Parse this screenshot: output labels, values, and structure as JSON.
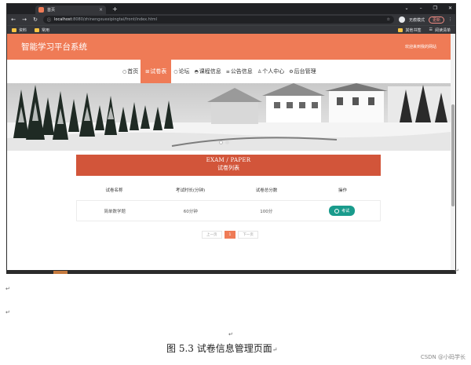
{
  "browser": {
    "tab_title": "首页",
    "tab_close": "×",
    "new_tab": "+",
    "window_controls": [
      "⌄",
      "–",
      "❐",
      "✕"
    ],
    "url_host": "localhost",
    "url_path": ":8080/zhinengxuexipingtai/front/index.html",
    "profile_label": "无痕模式",
    "update_label": "更新",
    "bookmarks": [
      "资料",
      "常用"
    ],
    "bookmarks_right": [
      "其他书签",
      "阅读清单"
    ]
  },
  "site": {
    "title": "智能学习平台系统",
    "welcome": "欢迎来到我的网站",
    "nav": [
      {
        "icon": "○",
        "label": "首页",
        "active": false
      },
      {
        "icon": "⊞",
        "label": "试卷表",
        "active": true
      },
      {
        "icon": "○",
        "label": "论坛",
        "active": false
      },
      {
        "icon": "◓",
        "label": "课程信息",
        "active": false
      },
      {
        "icon": "≡",
        "label": "公告信息",
        "active": false
      },
      {
        "icon": "♙",
        "label": "个人中心",
        "active": false
      },
      {
        "icon": "⚙",
        "label": "后台管理",
        "active": false
      }
    ],
    "section_en": "EXAM / PAPER",
    "section_cn": "试卷列表",
    "table": {
      "headers": [
        "试卷名称",
        "考试时长(分钟)",
        "试卷总分数",
        "操作"
      ],
      "rows": [
        {
          "name": "简单数学题",
          "duration": "60分钟",
          "score": "100分",
          "action": "考试"
        }
      ]
    },
    "pager": {
      "prev": "上一页",
      "current": "1",
      "next": "下一页"
    }
  },
  "document": {
    "para_mark": "↵",
    "caption": "图 5.3 试卷信息管理页面",
    "caption_mark": "↵",
    "watermark": "CSDN @小码学长"
  },
  "colors": {
    "accent": "#ef7b56",
    "section": "#d2553a",
    "exam_button": "#199b8c"
  }
}
